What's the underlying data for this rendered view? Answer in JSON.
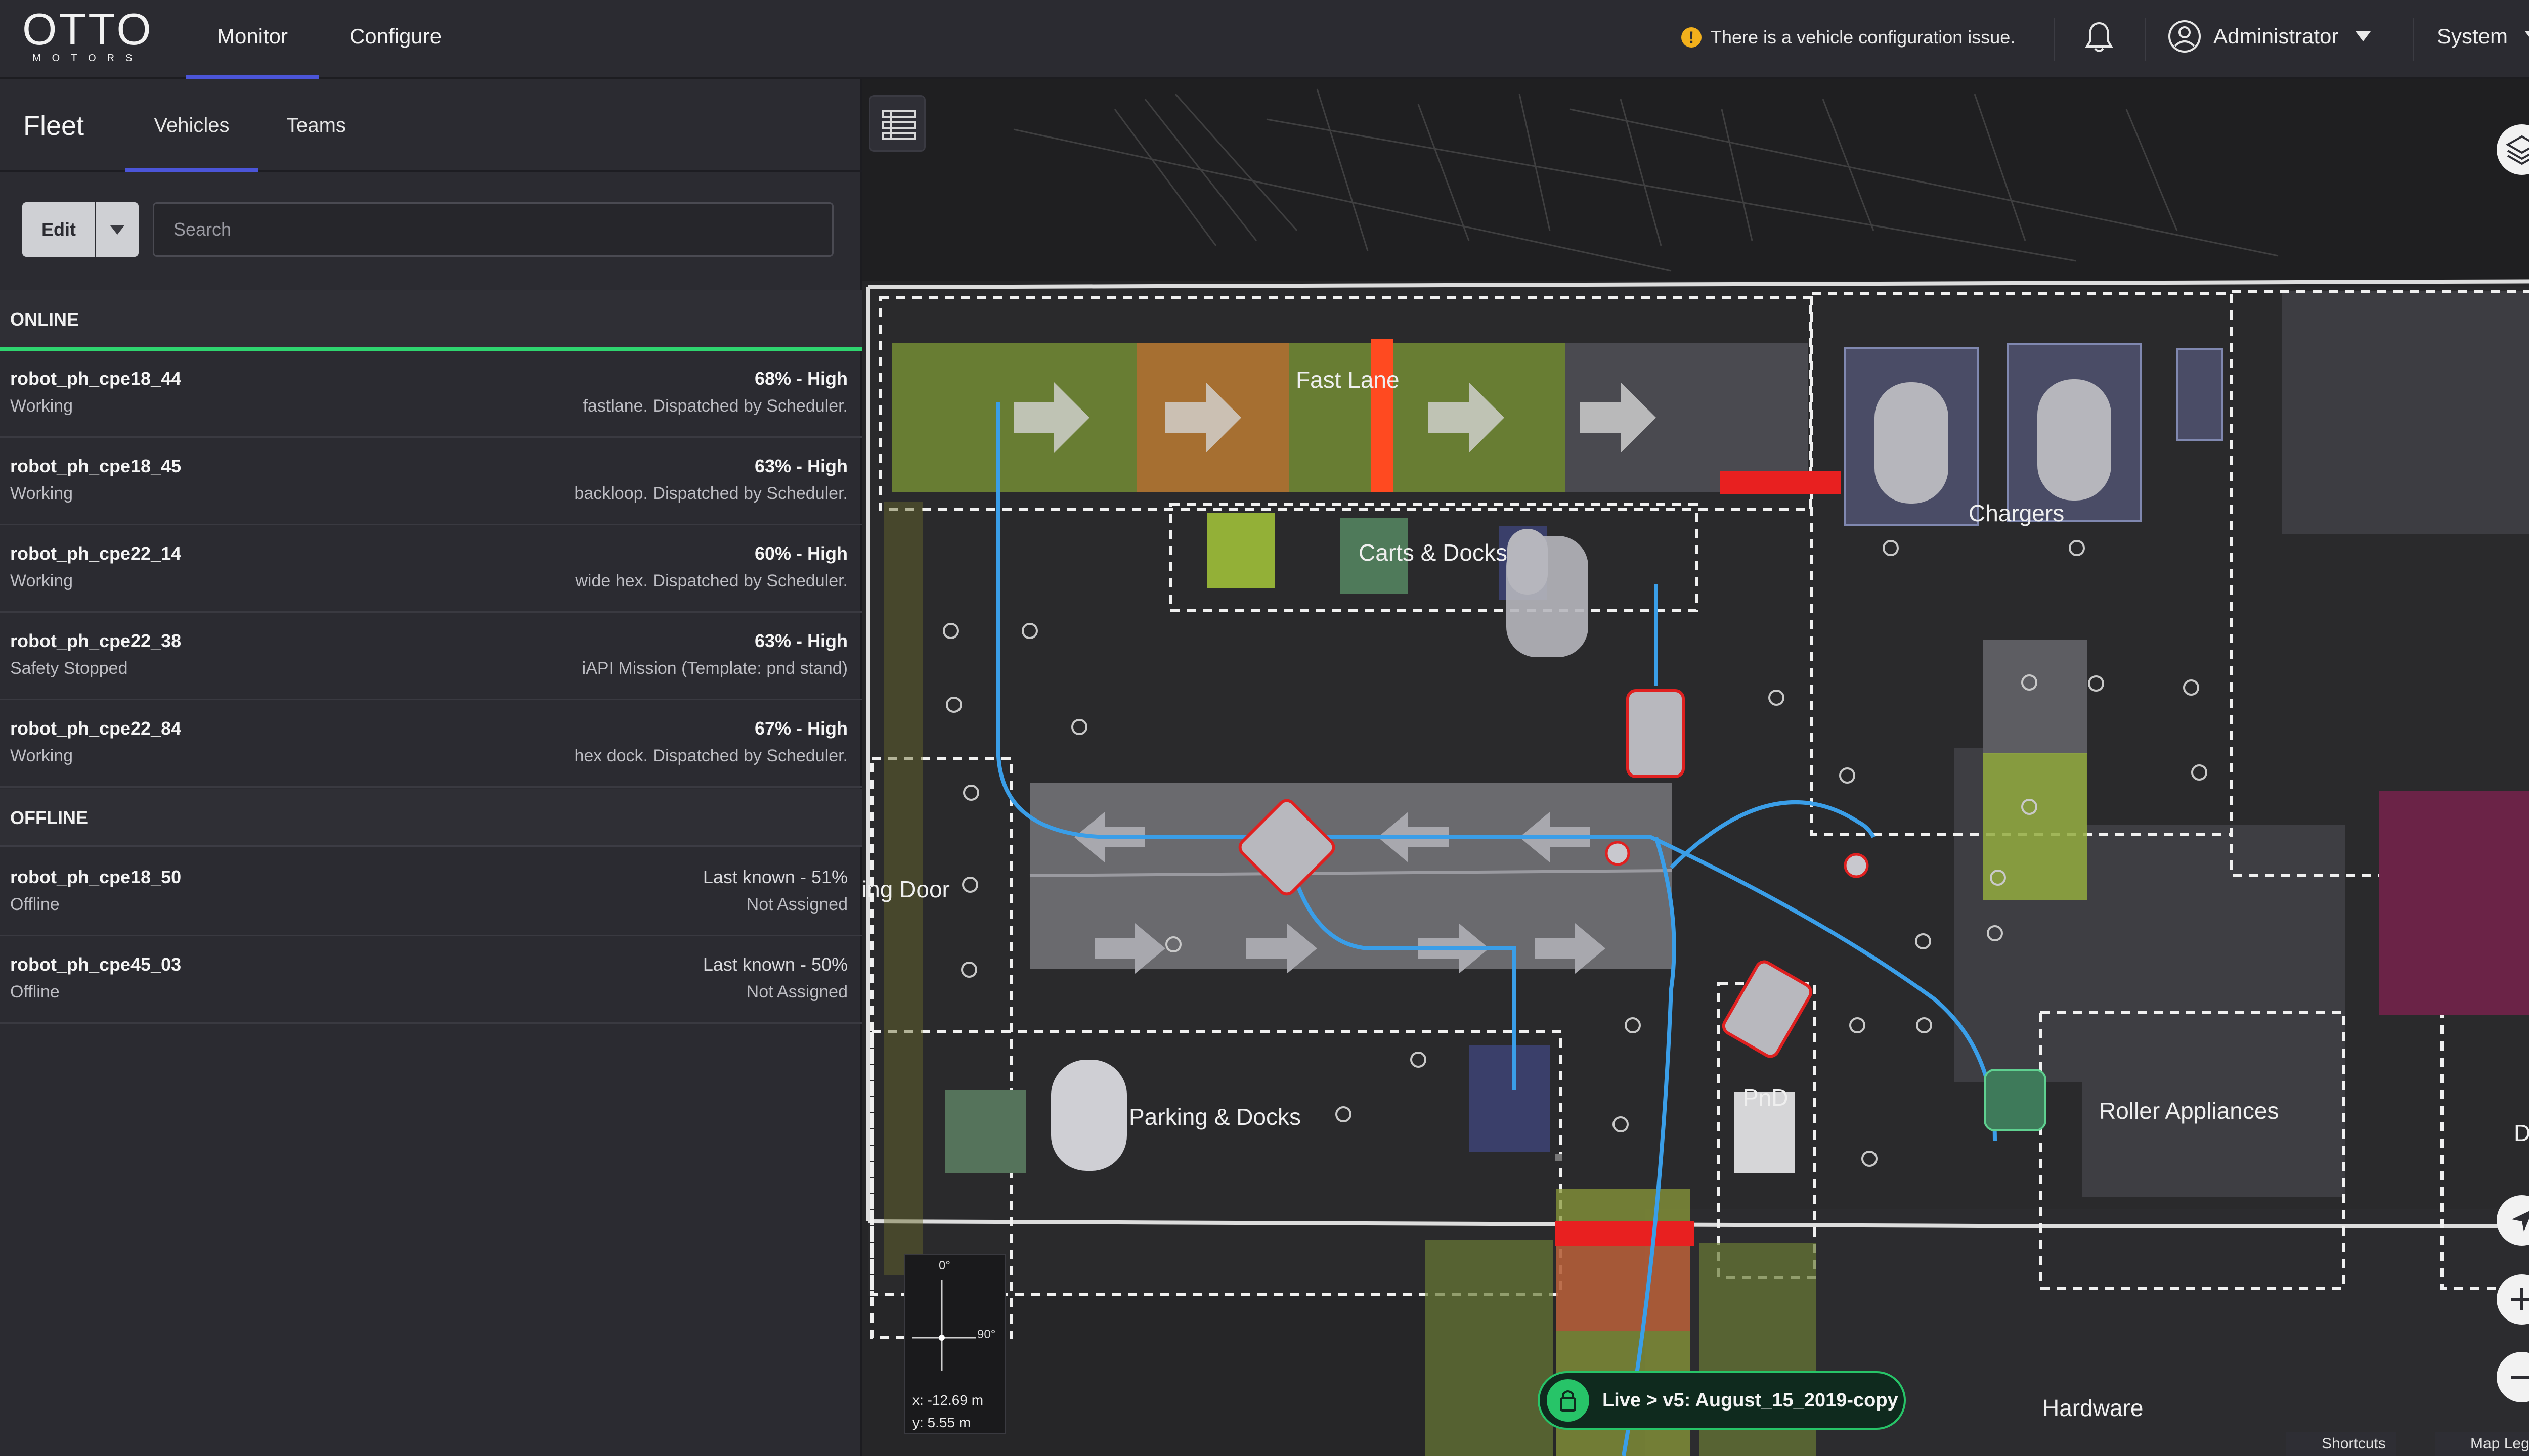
{
  "app": {
    "logo_text": "OTTO",
    "logo_subtext": "MOTORS"
  },
  "nav": {
    "tabs": [
      {
        "label": "Monitor",
        "active": true
      },
      {
        "label": "Configure",
        "active": false
      }
    ],
    "notice": "There is a vehicle configuration issue.",
    "user_label": "Administrator",
    "system_label": "System"
  },
  "fleet": {
    "title": "Fleet",
    "tabs": [
      {
        "label": "Vehicles",
        "active": true
      },
      {
        "label": "Teams",
        "active": false
      }
    ],
    "edit_label": "Edit",
    "search_placeholder": "Search",
    "online_label": "ONLINE",
    "offline_label": "OFFLINE",
    "online": [
      {
        "name": "robot_ph_cpe18_44",
        "status": "Working",
        "battery": "68% - High",
        "task": "fastlane. Dispatched by Scheduler."
      },
      {
        "name": "robot_ph_cpe18_45",
        "status": "Working",
        "battery": "63% - High",
        "task": "backloop. Dispatched by Scheduler."
      },
      {
        "name": "robot_ph_cpe22_14",
        "status": "Working",
        "battery": "60% - High",
        "task": "wide hex. Dispatched by Scheduler."
      },
      {
        "name": "robot_ph_cpe22_38",
        "status": "Safety Stopped",
        "battery": "63% - High",
        "task": "iAPI Mission (Template: pnd stand)"
      },
      {
        "name": "robot_ph_cpe22_84",
        "status": "Working",
        "battery": "67% - High",
        "task": "hex dock. Dispatched by Scheduler."
      }
    ],
    "offline": [
      {
        "name": "robot_ph_cpe18_50",
        "status": "Offline",
        "battery": "Last known - 51%",
        "task": "Not Assigned"
      },
      {
        "name": "robot_ph_cpe45_03",
        "status": "Offline",
        "battery": "Last known - 50%",
        "task": "Not Assigned"
      }
    ]
  },
  "map": {
    "zones": {
      "fast_lane": "Fast Lane",
      "carts_docks": "Carts & Docks",
      "chargers": "Chargers",
      "door": "ing Door",
      "parking_docks": "Parking & Docks",
      "pnd": "PnD",
      "roller": "Roller Appliances",
      "desks": "Desks",
      "hardware": "Hardware"
    },
    "compass": {
      "deg0": "0°",
      "deg90": "90°",
      "x": "x: -12.69 m",
      "y": "y: 5.55 m"
    },
    "live_label": "Live > v5: August_15_2019-copy",
    "shortcuts_label": "Shortcuts",
    "legend_label": "Map Legend",
    "colors": {
      "path": "#3a9ee8",
      "zone_green": "#8fae3c",
      "zone_red": "#e8231f",
      "zone_orange": "#c9682f",
      "zone_magenta": "#6b2347"
    }
  }
}
